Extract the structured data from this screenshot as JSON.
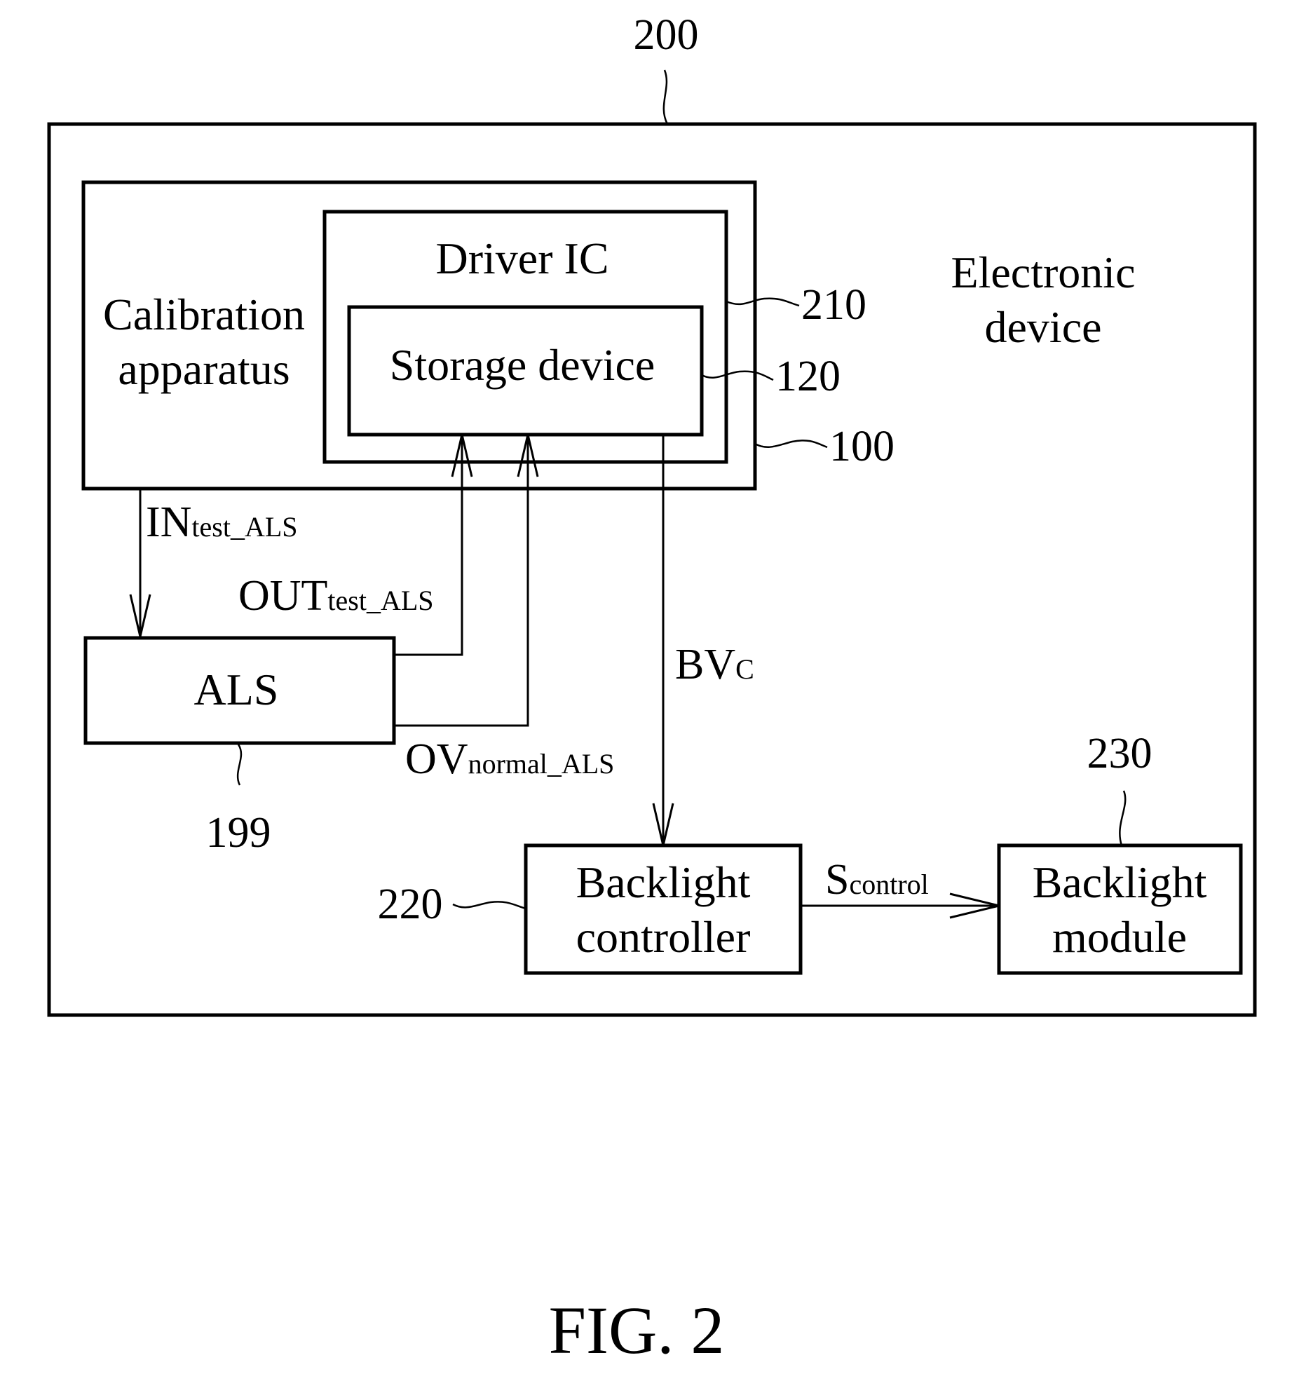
{
  "figure": {
    "caption": "FIG. 2",
    "ref_numbers": {
      "electronic_device": "200",
      "driver_ic": "210",
      "storage_device": "120",
      "calibration_apparatus": "100",
      "als": "199",
      "backlight_controller": "220",
      "backlight_module": "230"
    },
    "blocks": {
      "electronic_device": [
        "Electronic",
        "device"
      ],
      "calibration_apparatus": [
        "Calibration",
        "apparatus"
      ],
      "driver_ic": "Driver IC",
      "storage_device": "Storage device",
      "als": "ALS",
      "backlight_controller": [
        "Backlight",
        "controller"
      ],
      "backlight_module": [
        "Backlight",
        "module"
      ]
    },
    "signals": {
      "in_test": {
        "main": "IN",
        "sub": "test_ALS"
      },
      "out_test": {
        "main": "OUT",
        "sub": "test_ALS"
      },
      "ov_normal": {
        "main": "OV",
        "sub": "normal_ALS"
      },
      "bvc": {
        "main": "BV",
        "sub": "C"
      },
      "s_control": {
        "main": "S",
        "sub": "control"
      }
    }
  }
}
